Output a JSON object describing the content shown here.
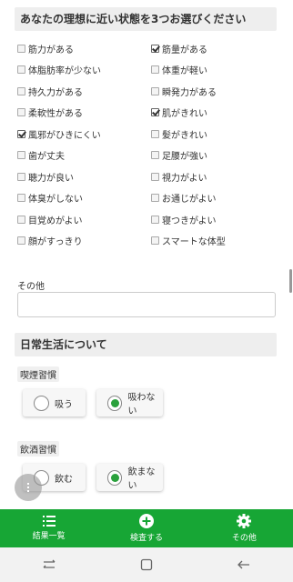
{
  "section1": {
    "title": "あなたの理想に近い状態を3つお選びください",
    "options": [
      {
        "label": "筋力がある",
        "checked": false
      },
      {
        "label": "筋量がある",
        "checked": true
      },
      {
        "label": "体脂肪率が少ない",
        "checked": false
      },
      {
        "label": "体重が軽い",
        "checked": false
      },
      {
        "label": "持久力がある",
        "checked": false
      },
      {
        "label": "瞬発力がある",
        "checked": false
      },
      {
        "label": "柔軟性がある",
        "checked": false
      },
      {
        "label": "肌がきれい",
        "checked": true
      },
      {
        "label": "風邪がひきにくい",
        "checked": true
      },
      {
        "label": "髪がきれい",
        "checked": false
      },
      {
        "label": "歯が丈夫",
        "checked": false
      },
      {
        "label": "足腰が強い",
        "checked": false
      },
      {
        "label": "聴力が良い",
        "checked": false
      },
      {
        "label": "視力がよい",
        "checked": false
      },
      {
        "label": "体臭がしない",
        "checked": false
      },
      {
        "label": "お通じがよい",
        "checked": false
      },
      {
        "label": "目覚めがよい",
        "checked": false
      },
      {
        "label": "寝つきがよい",
        "checked": false
      },
      {
        "label": "顔がすっきり",
        "checked": false
      },
      {
        "label": "スマートな体型",
        "checked": false
      }
    ]
  },
  "other": {
    "label": "その他",
    "value": "",
    "placeholder": ""
  },
  "section2": {
    "title": "日常生活について",
    "smoking": {
      "label": "喫煙習慣",
      "options": [
        "吸う",
        "吸わない"
      ],
      "selected": 1
    },
    "drinking": {
      "label": "飲酒習慣",
      "options": [
        "飲む",
        "飲まない"
      ],
      "selected": 1
    }
  },
  "nav": {
    "items": [
      {
        "label": "結果一覧",
        "icon": "list-icon"
      },
      {
        "label": "検査する",
        "icon": "plus-circle-icon"
      },
      {
        "label": "その他",
        "icon": "gear-icon"
      }
    ],
    "color": "#17a635"
  }
}
